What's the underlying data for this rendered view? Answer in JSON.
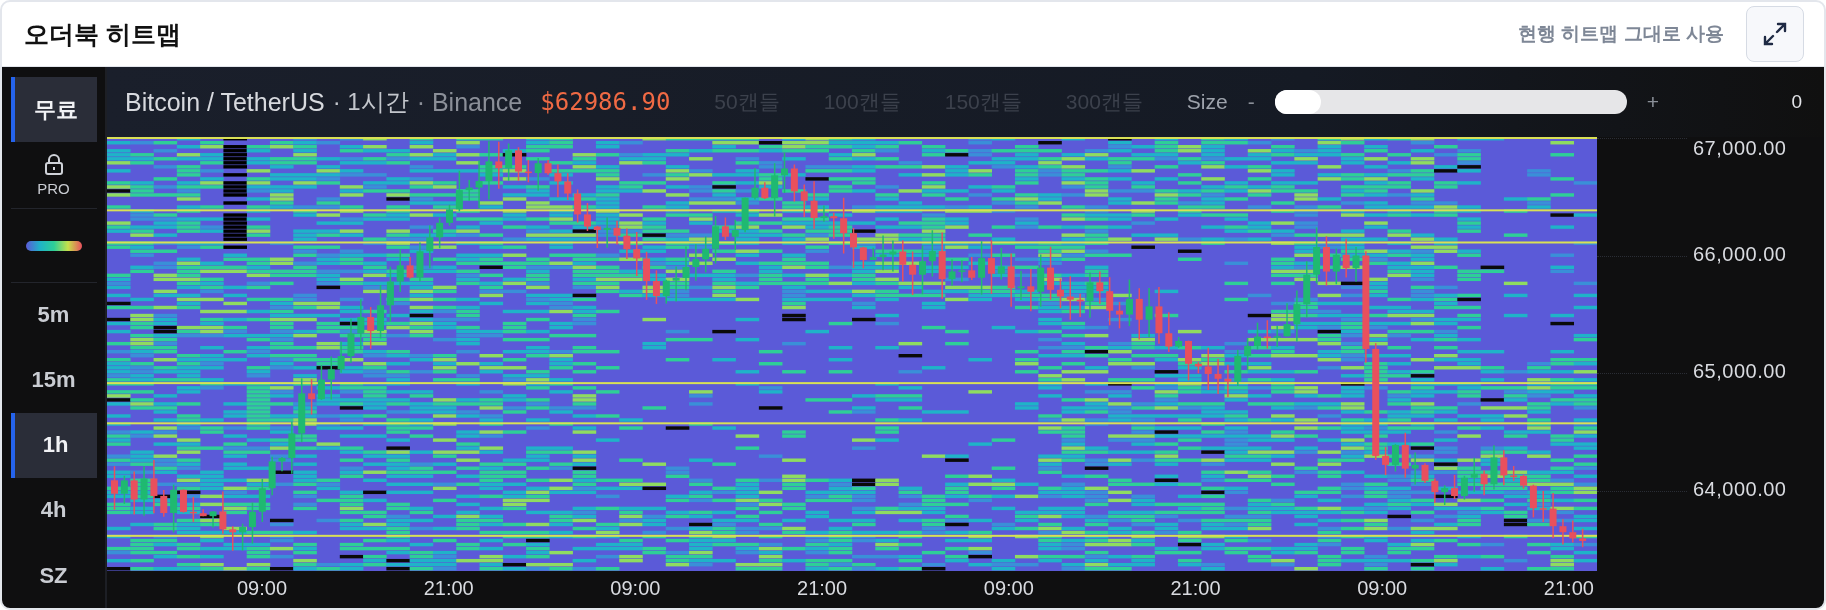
{
  "header": {
    "title": "오더북 히트맵",
    "action_link": "현행 히트맵 그대로 사용"
  },
  "sidebar": {
    "items": [
      {
        "kind": "tab",
        "label": "무료",
        "selected": true
      },
      {
        "kind": "locked",
        "label": "PRO",
        "selected": false
      },
      {
        "kind": "legend",
        "selected": false
      },
      {
        "kind": "tab",
        "label": "5m",
        "selected": false
      },
      {
        "kind": "tab",
        "label": "15m",
        "selected": false
      },
      {
        "kind": "tab",
        "label": "1h",
        "selected": true
      },
      {
        "kind": "tab",
        "label": "4h",
        "selected": false
      },
      {
        "kind": "tab",
        "label": "SZ",
        "selected": false
      }
    ]
  },
  "chart": {
    "symbol": "Bitcoin / TetherUS",
    "interval": "· 1시간",
    "exchange": "· Binance",
    "price": "$62986.90",
    "candle_options": [
      {
        "label": "50캔들",
        "disabled": true
      },
      {
        "label": "100캔들",
        "disabled": true
      },
      {
        "label": "150캔들",
        "disabled": true
      },
      {
        "label": "300캔들",
        "disabled": true
      }
    ],
    "size_slider": {
      "label": "Size",
      "minus": "-",
      "plus": "+",
      "level": 0,
      "value": "0"
    },
    "y_axis": [
      "67,000.00",
      "66,000.00",
      "65,000.00",
      "64,000.00"
    ],
    "x_axis": [
      "09:00",
      "21:00",
      "09:00",
      "21:00",
      "09:00",
      "21:00",
      "09:00",
      "21:00"
    ]
  }
}
